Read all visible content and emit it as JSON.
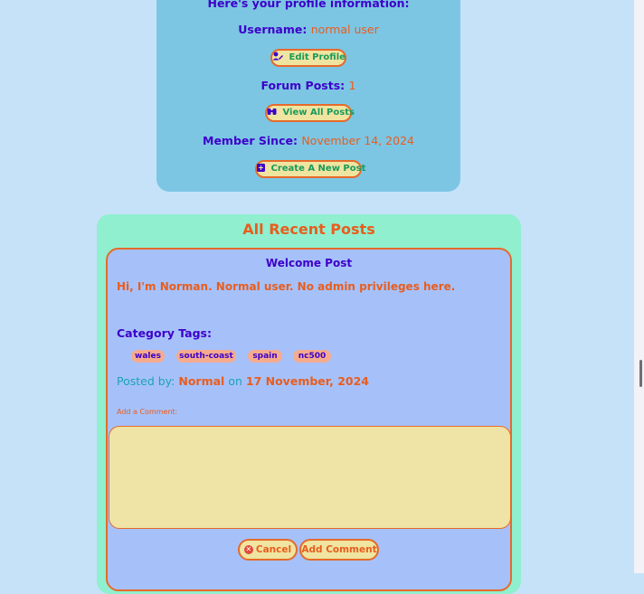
{
  "profile": {
    "heading": "Here's your profile information:",
    "username_label": "Username:",
    "username_value": "normal user",
    "edit_profile_label": "Edit Profile",
    "forum_posts_label": "Forum Posts:",
    "forum_posts_value": "1",
    "view_all_posts_label": "View All Posts",
    "member_since_label": "Member Since:",
    "member_since_value": "November 14, 2024",
    "create_post_label": "Create A New Post"
  },
  "recent_posts": {
    "title": "All Recent Posts",
    "posts": [
      {
        "title": "Welcome Post",
        "body": "Hi, I'm Norman. Normal user. No admin privileges here.",
        "tags_label": "Category Tags:",
        "tags": [
          "wales",
          "south-coast",
          "spain",
          "nc500"
        ],
        "posted_by_label": "Posted by:",
        "author": "Normal",
        "on_label": "on",
        "date": "17 November, 2024",
        "comment_label": "Add a Comment:",
        "comment_value": "",
        "cancel_label": "Cancel",
        "add_comment_label": "Add Comment"
      }
    ]
  },
  "icons": {
    "edit_profile": "user-pen-icon",
    "view_all_posts": "binoculars-icon",
    "create_post": "plus-square-icon",
    "cancel": "circle-x-icon"
  },
  "colors": {
    "page_bg": "#c6e2f8",
    "profile_card_bg": "#7cc6e4",
    "posts_card_bg": "#90efce",
    "post_bg": "#a6c1fa",
    "accent_orange": "#e85d1e",
    "heading_purple": "#3d00c9",
    "button_bg": "#efe4a0",
    "button_text_green": "#1a9a5a",
    "meta_teal": "#1ca3b8",
    "tag_bg": "#f5ab8e"
  }
}
